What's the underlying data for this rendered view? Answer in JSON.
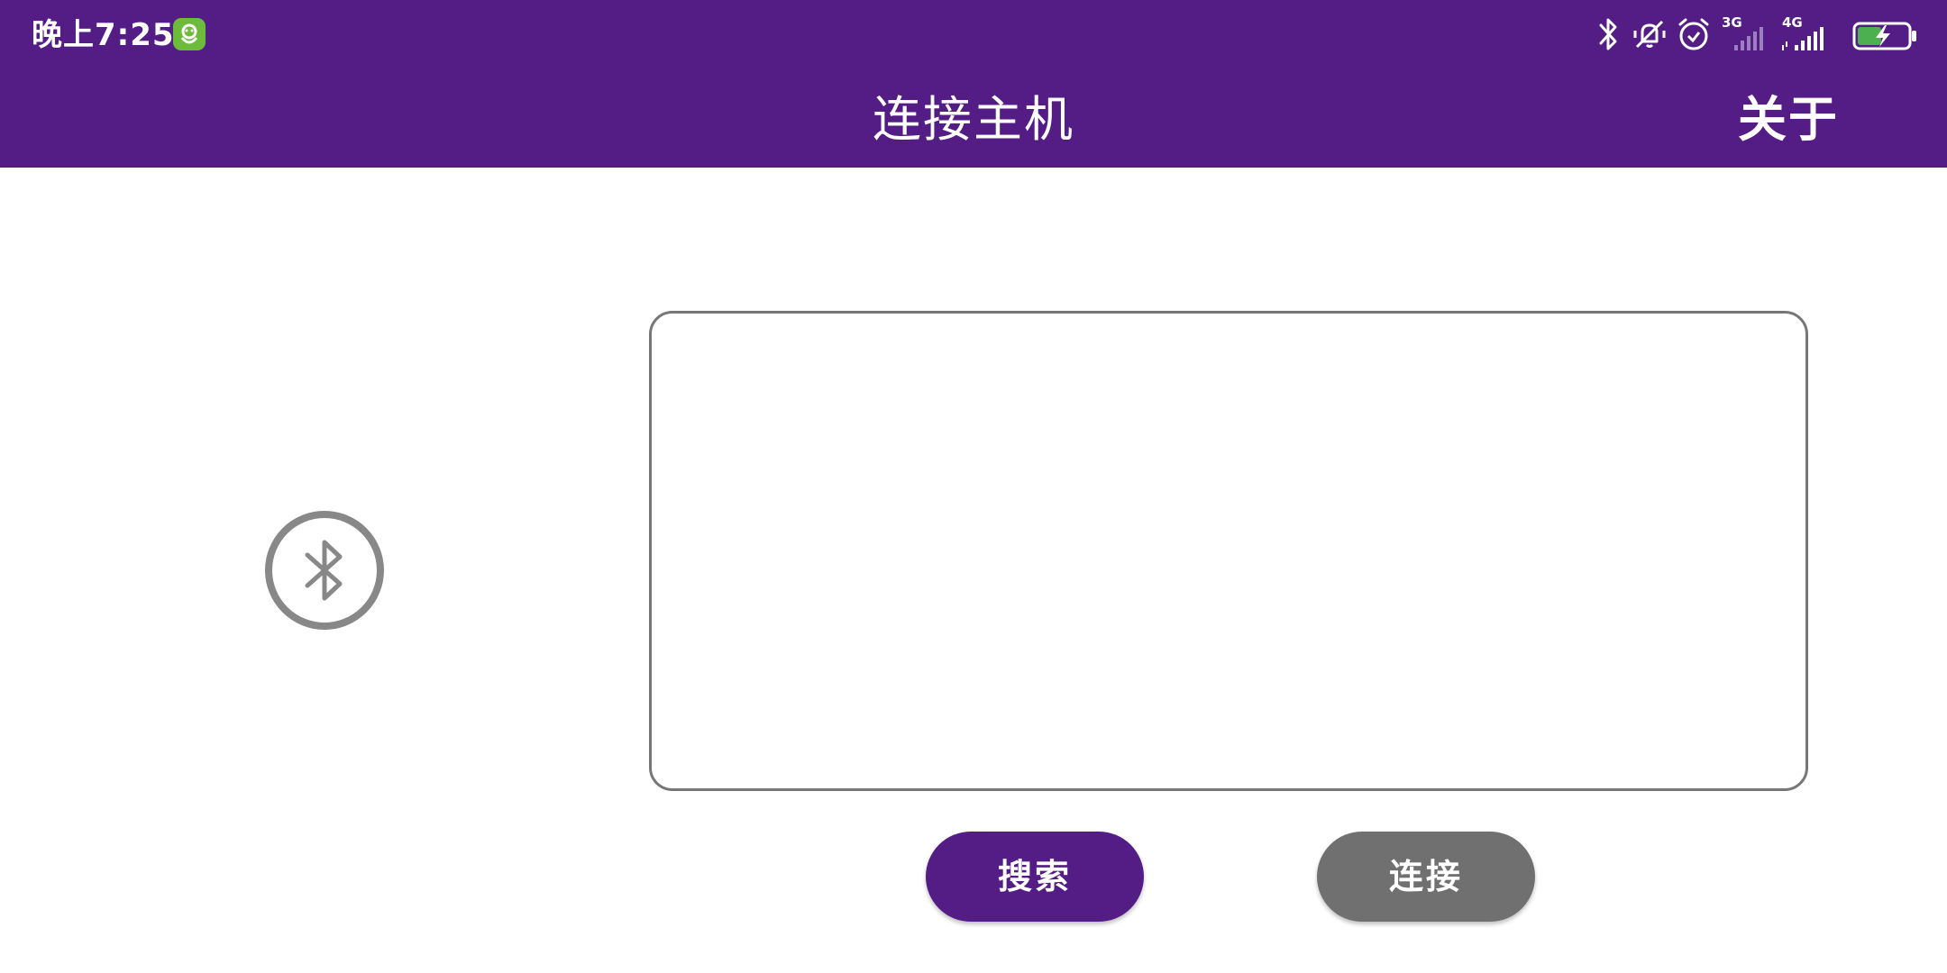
{
  "status_bar": {
    "time": "晚上7:25",
    "network_3g": "3G",
    "network_4g": "4G",
    "icons": [
      "app-notification-icon",
      "bluetooth-icon",
      "vibrate-off-icon",
      "alarm-icon",
      "signal-3g-icon",
      "signal-4g-icon",
      "battery-charging-icon"
    ]
  },
  "app_bar": {
    "title": "连接主机",
    "about_label": "关于"
  },
  "main": {
    "bluetooth_status_icon": "bluetooth-circle-icon",
    "device_list": [],
    "search_label": "搜索",
    "connect_label": "连接"
  },
  "colors": {
    "primary": "#541d86",
    "disabled_button": "#707070",
    "border": "#777777"
  }
}
